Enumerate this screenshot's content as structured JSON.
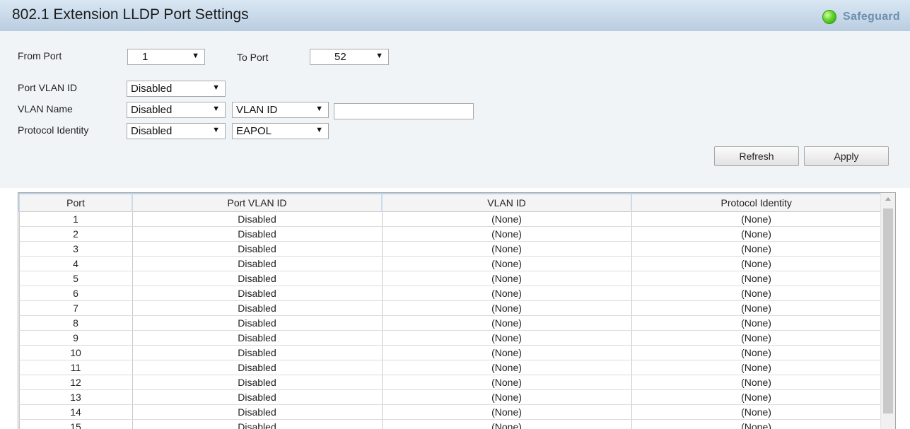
{
  "header": {
    "title": "802.1 Extension LLDP Port Settings",
    "safeguard_label": "Safeguard",
    "safeguard_color": "#4ccf24"
  },
  "form": {
    "from_port_label": "From Port",
    "from_port_value": "1",
    "to_port_label": "To Port",
    "to_port_value": "52",
    "port_vlan_id_label": "Port VLAN ID",
    "port_vlan_id_value": "Disabled",
    "vlan_name_label": "VLAN Name",
    "vlan_name_value": "Disabled",
    "vlan_name_type_value": "VLAN ID",
    "vlan_name_input_value": "",
    "protocol_identity_label": "Protocol Identity",
    "protocol_identity_value": "Disabled",
    "protocol_identity_type_value": "EAPOL"
  },
  "buttons": {
    "refresh": "Refresh",
    "apply": "Apply"
  },
  "table": {
    "headers": [
      "Port",
      "Port VLAN ID",
      "VLAN ID",
      "Protocol Identity"
    ],
    "rows": [
      [
        "1",
        "Disabled",
        "(None)",
        "(None)"
      ],
      [
        "2",
        "Disabled",
        "(None)",
        "(None)"
      ],
      [
        "3",
        "Disabled",
        "(None)",
        "(None)"
      ],
      [
        "4",
        "Disabled",
        "(None)",
        "(None)"
      ],
      [
        "5",
        "Disabled",
        "(None)",
        "(None)"
      ],
      [
        "6",
        "Disabled",
        "(None)",
        "(None)"
      ],
      [
        "7",
        "Disabled",
        "(None)",
        "(None)"
      ],
      [
        "8",
        "Disabled",
        "(None)",
        "(None)"
      ],
      [
        "9",
        "Disabled",
        "(None)",
        "(None)"
      ],
      [
        "10",
        "Disabled",
        "(None)",
        "(None)"
      ],
      [
        "11",
        "Disabled",
        "(None)",
        "(None)"
      ],
      [
        "12",
        "Disabled",
        "(None)",
        "(None)"
      ],
      [
        "13",
        "Disabled",
        "(None)",
        "(None)"
      ],
      [
        "14",
        "Disabled",
        "(None)",
        "(None)"
      ],
      [
        "15",
        "Disabled",
        "(None)",
        "(None)"
      ]
    ]
  },
  "icons": {
    "status": "green-status-dot-icon",
    "dropdown": "triangle-down-icon",
    "scroll_up": "scroll-up-arrow-icon"
  }
}
